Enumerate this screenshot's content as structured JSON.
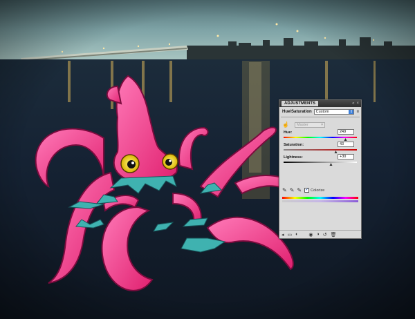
{
  "panel": {
    "tab_label": "ADJUSTMENTS",
    "adjustment_label": "Hue/Saturation",
    "preset_value": "Custom",
    "channel_value": "Master",
    "hue": {
      "label": "Hue:",
      "value": "249",
      "level": 0.846
    },
    "saturation": {
      "label": "Saturation:",
      "value": "43",
      "level": 0.715
    },
    "lightness": {
      "label": "Lightness:",
      "value": "+30",
      "level": 0.65
    },
    "colorize": {
      "label": "Colorize",
      "checked": true
    }
  },
  "colors": {
    "squid_pink": "#ee2f86",
    "squid_highlight": "#ff8ec4",
    "water_teal": "#3fb2b0",
    "sky_teal": "#6a9aa0",
    "water_dark": "#1b2535"
  },
  "icons": [
    "hand-icon",
    "eyedropper-icon",
    "eyedropper-plus-icon",
    "eyedropper-minus-icon",
    "panel-menu-icon",
    "back-arrow-icon",
    "new-layer-icon",
    "eye-icon",
    "reset-icon",
    "trash-icon"
  ]
}
